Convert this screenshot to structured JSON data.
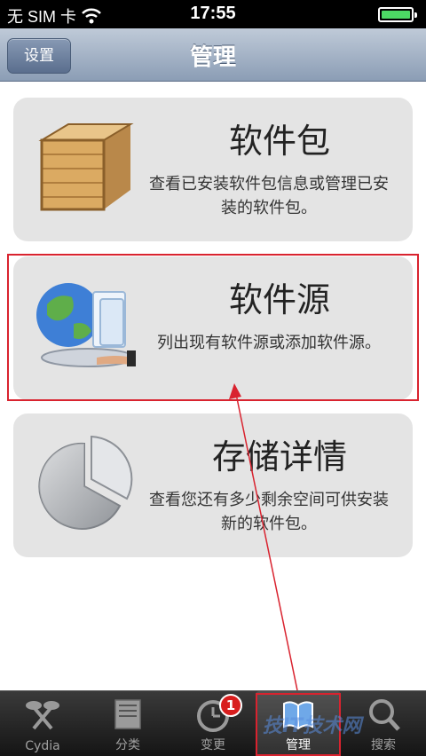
{
  "status_bar": {
    "carrier": "无 SIM 卡",
    "time": "17:55"
  },
  "nav": {
    "back_label": "设置",
    "title": "管理"
  },
  "cards": [
    {
      "title": "软件包",
      "desc": "查看已安装软件包信息或管理已安装的软件包。",
      "icon": "package-box-icon"
    },
    {
      "title": "软件源",
      "desc": "列出现有软件源或添加软件源。",
      "icon": "globe-source-icon"
    },
    {
      "title": "存储详情",
      "desc": "查看您还有多少剩余空间可供安装新的软件包。",
      "icon": "storage-pie-icon"
    }
  ],
  "tabs": [
    {
      "label": "Cydia",
      "icon": "cydia-icon"
    },
    {
      "label": "分类",
      "icon": "categories-icon"
    },
    {
      "label": "变更",
      "icon": "changes-clock-icon",
      "badge": "1"
    },
    {
      "label": "管理",
      "icon": "manage-book-icon",
      "active": true
    },
    {
      "label": "搜索",
      "icon": "search-icon"
    }
  ],
  "watermark": "技IT技术网",
  "colors": {
    "annotation_red": "#d9232f",
    "nav_gradient_top": "#bfcad8",
    "nav_gradient_bottom": "#8b9db5",
    "card_bg": "#e4e4e4"
  }
}
